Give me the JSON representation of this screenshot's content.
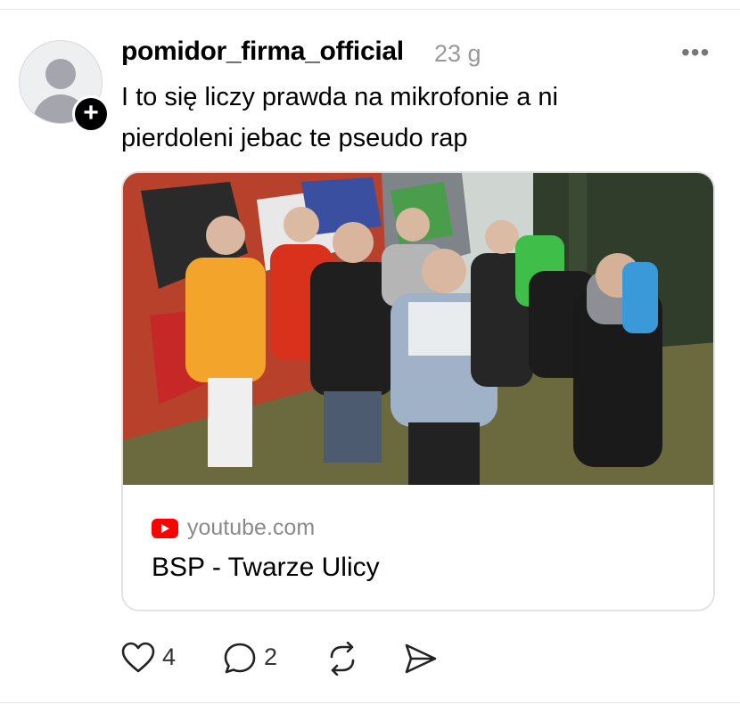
{
  "post": {
    "username": "pomidor_firma_official",
    "timestamp": "23 g",
    "text_lines": [
      "I to się liczy prawda na mikrofonie a ni",
      "pierdoleni jebac te pseudo rap"
    ],
    "follow_badge": "+",
    "more_menu": "•••"
  },
  "link_card": {
    "source_icon": "youtube-icon",
    "domain": "youtube.com",
    "title": "BSP - Twarze Ulicy",
    "image_description": "group of young men standing in front of a graffiti wall"
  },
  "actions": {
    "like_count": "4",
    "reply_count": "2",
    "icons": [
      "heart-icon",
      "comment-icon",
      "repost-icon",
      "share-icon"
    ]
  },
  "colors": {
    "youtube_red": "#ff0000",
    "muted_text": "#999999",
    "border": "#e2e2e2"
  }
}
